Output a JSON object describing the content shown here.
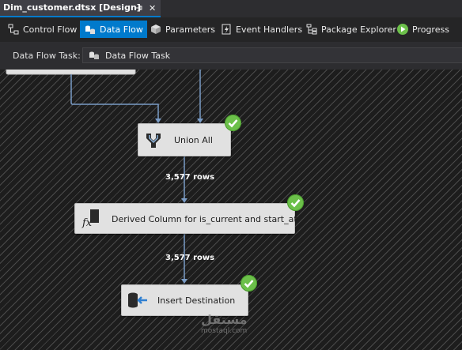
{
  "document_tab": {
    "title": "Dim_customer.dtsx [Design]",
    "pin_icon": "pin-icon",
    "close_icon": "close-icon",
    "close_glyph": "✕"
  },
  "designer_tabs": [
    {
      "label": "Control Flow",
      "icon": "control-flow-icon",
      "active": false
    },
    {
      "label": "Data Flow",
      "icon": "data-flow-icon",
      "active": true
    },
    {
      "label": "Parameters",
      "icon": "parameters-icon",
      "active": false
    },
    {
      "label": "Event Handlers",
      "icon": "event-handlers-icon",
      "active": false
    },
    {
      "label": "Package Explorer",
      "icon": "package-explorer-icon",
      "active": false
    },
    {
      "label": "Progress",
      "icon": "progress-play-icon",
      "active": false
    }
  ],
  "task_selector": {
    "label": "Data Flow Task:",
    "value": "Data Flow Task",
    "icon": "data-flow-task-icon"
  },
  "canvas": {
    "components": [
      {
        "name": "Union All",
        "icon": "union-all-icon",
        "status": "success"
      },
      {
        "name": "Derived Column for is_current and start_at",
        "icon": "derived-column-icon",
        "status": "success"
      },
      {
        "name": "Insert Destination",
        "icon": "destination-icon",
        "status": "success"
      }
    ],
    "paths": [
      {
        "rows": "3,577 rows"
      },
      {
        "rows": "3,577 rows"
      }
    ]
  },
  "watermark": {
    "logo": "مستقل",
    "text": "mostaql.com"
  },
  "colors": {
    "accent": "#007acc",
    "success": "#6cc04a",
    "canvas_background": "#1d1d1d",
    "path_line": "#7a9cc6"
  }
}
